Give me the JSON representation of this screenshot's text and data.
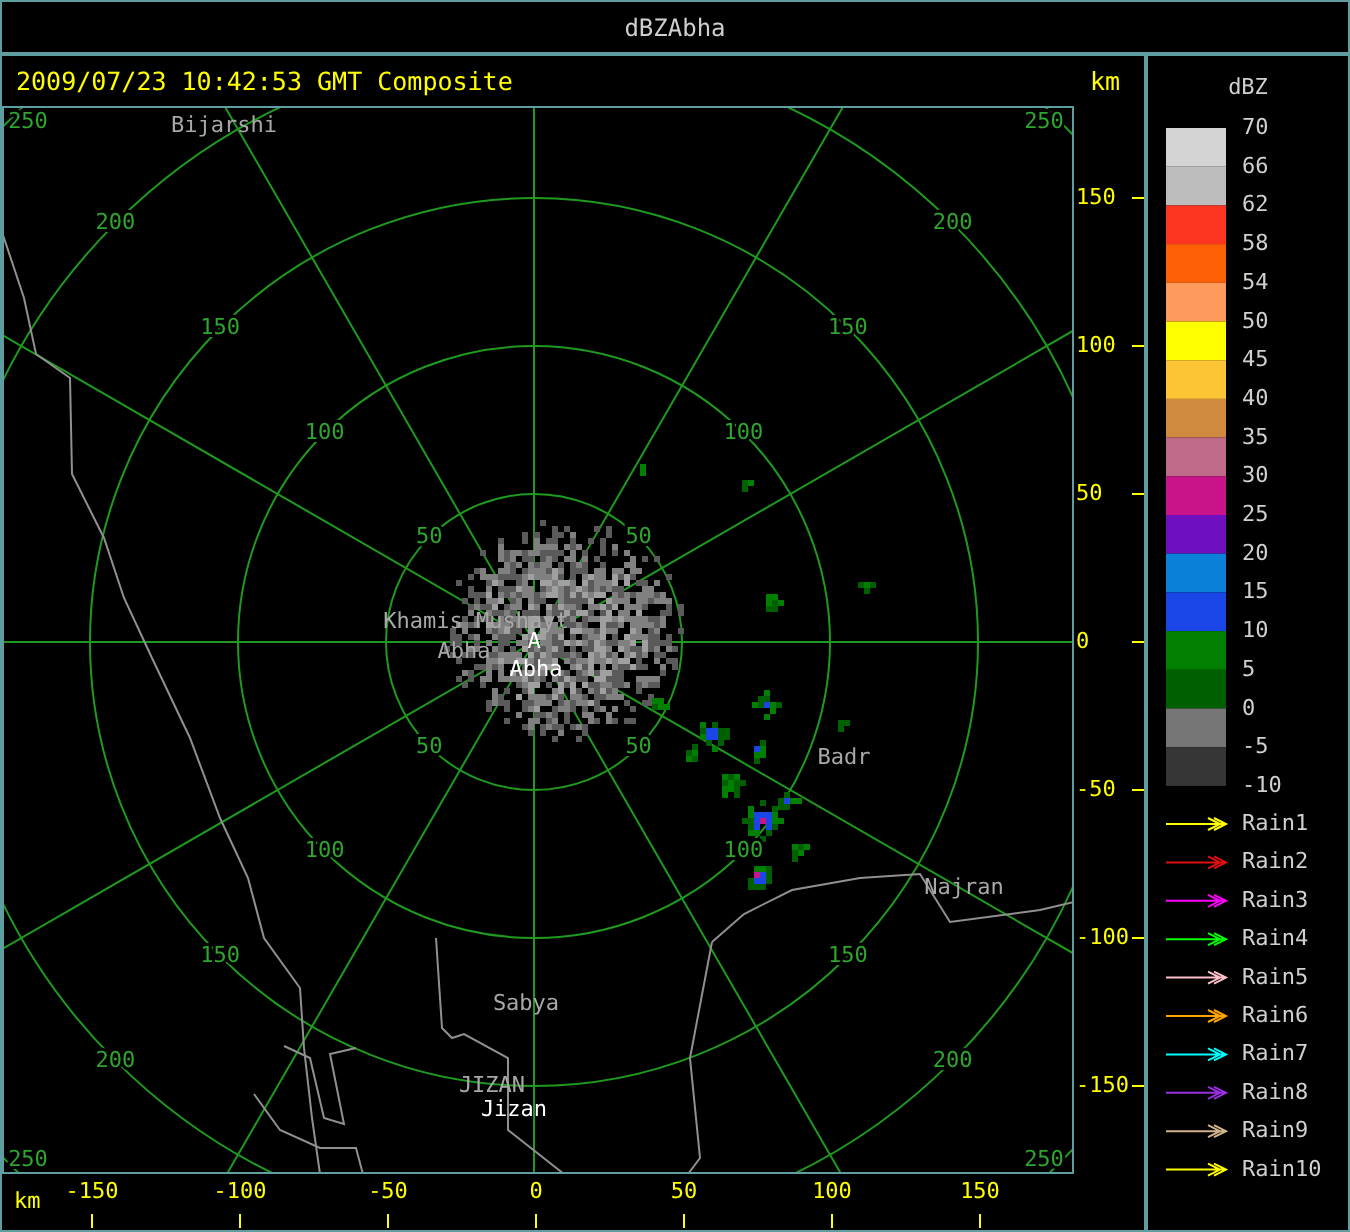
{
  "window": {
    "title": "dBZAbha"
  },
  "header": {
    "timestamp": "2009/07/23 10:42:53 GMT Composite",
    "unit": "km"
  },
  "plot": {
    "rings": [
      {
        "labels": [
          "50",
          "50",
          "50",
          "50"
        ]
      },
      {
        "labels": [
          "100",
          "100",
          "100",
          "100"
        ]
      },
      {
        "labels": [
          "150",
          "150",
          "150",
          "150"
        ]
      },
      {
        "labels": [
          "200",
          "200",
          "200",
          "200"
        ]
      },
      {
        "labels": [
          "250",
          "250",
          "250",
          "250"
        ]
      }
    ],
    "places": [
      {
        "name": "Bijarshi",
        "kind": "town"
      },
      {
        "name": "Khamis Mushayt",
        "kind": "town"
      },
      {
        "name": "Abha",
        "kind": "town"
      },
      {
        "name": "A",
        "kind": "station"
      },
      {
        "name": "Abha",
        "kind": "station"
      },
      {
        "name": "Badr",
        "kind": "town"
      },
      {
        "name": "Najran",
        "kind": "town"
      },
      {
        "name": "Sabya",
        "kind": "town"
      },
      {
        "name": "JIZAN",
        "kind": "town"
      },
      {
        "name": "Jizan",
        "kind": "station"
      }
    ],
    "y_ticks": [
      "150",
      "100",
      "50",
      "0",
      "-50",
      "-100",
      "-150"
    ],
    "x_unit": "km",
    "x_ticks": [
      "-150",
      "-100",
      "-50",
      "0",
      "50",
      "100",
      "150"
    ]
  },
  "legend": {
    "title": "dBZ",
    "bins": [
      {
        "color": "#d4d4d4"
      },
      {
        "color": "#bdbdbd"
      },
      {
        "color": "#fc3520"
      },
      {
        "color": "#fd6006"
      },
      {
        "color": "#fd9a5c"
      },
      {
        "color": "#fefe00"
      },
      {
        "color": "#fbc535"
      },
      {
        "color": "#d08a40"
      },
      {
        "color": "#c06a8a"
      },
      {
        "color": "#c81488"
      },
      {
        "color": "#6e0fc0"
      },
      {
        "color": "#0a80d8"
      },
      {
        "color": "#1a46e8"
      },
      {
        "color": "#007f00"
      },
      {
        "color": "#005f00"
      },
      {
        "color": "#767676"
      },
      {
        "color": "#363636"
      }
    ],
    "bin_labels": [
      "70",
      "66",
      "62",
      "58",
      "54",
      "50",
      "45",
      "40",
      "35",
      "30",
      "25",
      "20",
      "15",
      "10",
      "5",
      "0",
      "-5",
      "-10"
    ],
    "tracks": [
      {
        "label": "Rain1",
        "color": "#ffff00"
      },
      {
        "label": "Rain2",
        "color": "#e01010"
      },
      {
        "label": "Rain3",
        "color": "#ff00ff"
      },
      {
        "label": "Rain4",
        "color": "#00ff00"
      },
      {
        "label": "Rain5",
        "color": "#ffc0cb"
      },
      {
        "label": "Rain6",
        "color": "#ffa500"
      },
      {
        "label": "Rain7",
        "color": "#00ffff"
      },
      {
        "label": "Rain8",
        "color": "#9a30e0"
      },
      {
        "label": "Rain9",
        "color": "#d2b48c"
      },
      {
        "label": "Rain10",
        "color": "#ffff00"
      }
    ]
  }
}
